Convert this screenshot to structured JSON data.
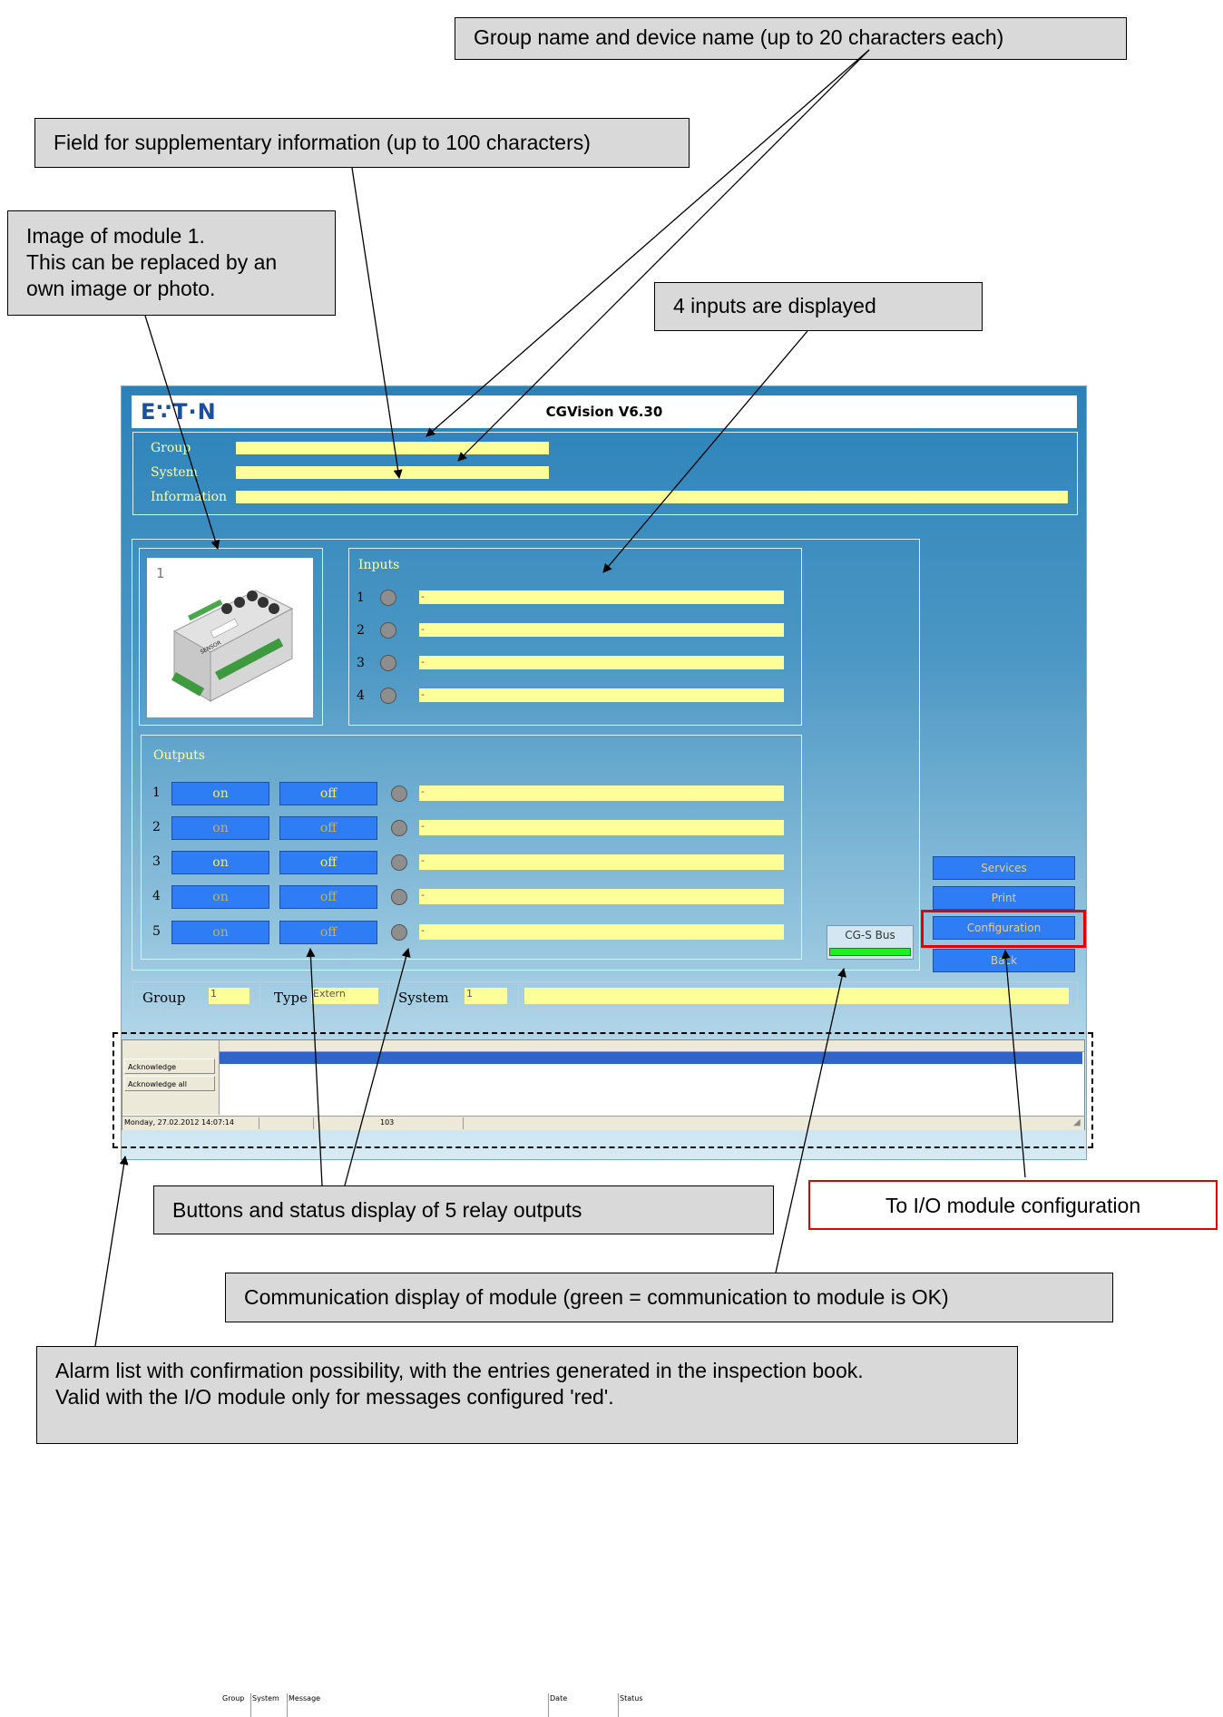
{
  "callouts": {
    "group_device": "Group name and device name (up to 20 characters each)",
    "supplementary": "Field for supplementary information (up to 100 characters)",
    "image_line1": "Image of module 1.",
    "image_line2": "This can be replaced by an",
    "image_line3": "own image or photo.",
    "inputs": "4 inputs are displayed",
    "relay": "Buttons and status display of 5 relay outputs",
    "config": "To I/O module configuration",
    "comm": "Communication display of module (green = communication to module is OK)",
    "alarm_line1": "Alarm list with confirmation possibility, with the entries generated in the inspection book.",
    "alarm_line2": "Valid with the I/O module only for messages configured 'red'."
  },
  "app": {
    "logo": "E∵T·N",
    "title": "CGVision V6.30"
  },
  "header_fields": {
    "group_label": "Group",
    "system_label": "System",
    "information_label": "Information"
  },
  "module": {
    "number": "1",
    "photo_label": "SENSOR"
  },
  "inputs": {
    "title": "Inputs",
    "rows": [
      {
        "num": "1",
        "text": "-"
      },
      {
        "num": "2",
        "text": "-"
      },
      {
        "num": "3",
        "text": "-"
      },
      {
        "num": "4",
        "text": "-"
      }
    ]
  },
  "outputs": {
    "title": "Outputs",
    "on_label": "on",
    "off_label": "off",
    "rows": [
      {
        "num": "1",
        "text": "-"
      },
      {
        "num": "2",
        "text": "-"
      },
      {
        "num": "3",
        "text": "-"
      },
      {
        "num": "4",
        "text": "-"
      },
      {
        "num": "5",
        "text": "-"
      }
    ]
  },
  "bus": {
    "label": "CG-S Bus",
    "color": "#22ee22"
  },
  "side_buttons": {
    "services": "Services",
    "print": "Print",
    "configuration": "Configuration",
    "back": "Back"
  },
  "info_bar": {
    "group_label": "Group",
    "group_value": "1",
    "type_label": "Type",
    "type_value": "Extern",
    "system_label": "System",
    "system_value": "1"
  },
  "alarm": {
    "acknowledge": "Acknowledge",
    "acknowledge_all": "Acknowledge all",
    "columns": [
      "Group",
      "System",
      "Message",
      "Date",
      "Status"
    ],
    "status_date": "Monday, 27.02.2012 14:07:14",
    "status_count": "103"
  },
  "colors": {
    "field_yellow": "#ffff99",
    "button_blue": "#2f7df4",
    "highlight_red": "#e00000"
  }
}
